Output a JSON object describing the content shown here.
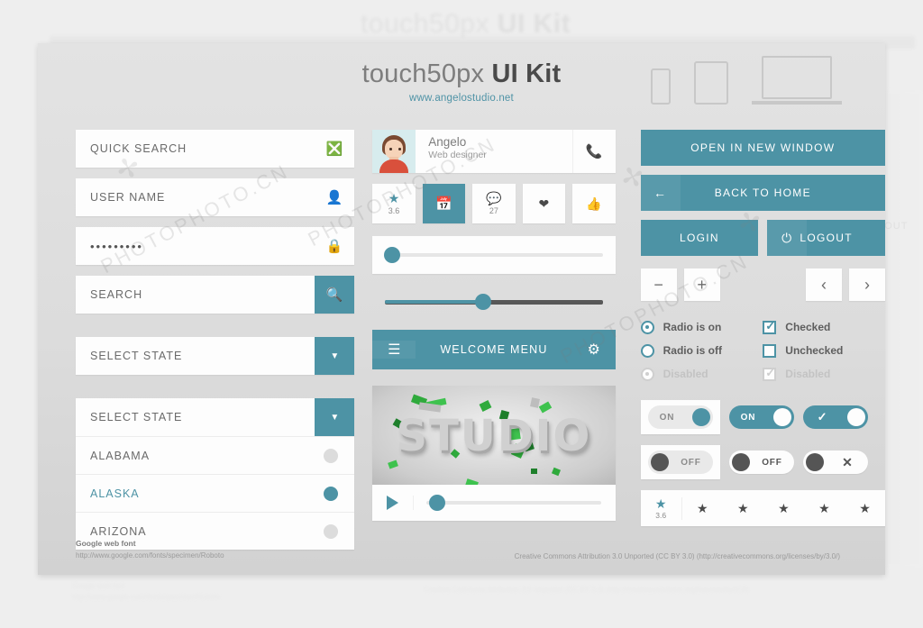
{
  "header": {
    "title_light": "touch50px",
    "title_bold": "UI Kit",
    "subtitle": "www.angelostudio.net",
    "devices": [
      "phone-icon",
      "tablet-icon",
      "laptop-icon"
    ]
  },
  "left_column": {
    "quick_search": {
      "label": "QUICK SEARCH",
      "icon": "close-circle-icon"
    },
    "user_name": {
      "label": "USER NAME",
      "icon": "user-icon"
    },
    "password": {
      "value": "•••••••••",
      "icon": "lock-icon"
    },
    "search": {
      "label": "SEARCH",
      "icon": "search-icon"
    },
    "select_state": {
      "label": "SELECT STATE",
      "icon": "chevron-down-icon"
    },
    "select_state_open": {
      "label": "SELECT STATE",
      "icon": "chevron-down-icon",
      "options": [
        {
          "label": "ALABAMA",
          "selected": false
        },
        {
          "label": "ALASKA",
          "selected": true
        },
        {
          "label": "ARIZONA",
          "selected": false
        }
      ]
    }
  },
  "mid_column": {
    "contact": {
      "name": "Angelo",
      "role": "Web designer",
      "action_icon": "phone-icon"
    },
    "icon_tiles": [
      {
        "icon": "star-icon",
        "value": "3.6",
        "active": false
      },
      {
        "icon": "calendar-icon",
        "value": "",
        "active": true
      },
      {
        "icon": "comment-icon",
        "value": "27",
        "active": false
      },
      {
        "icon": "heart-icon",
        "value": "",
        "active": false
      },
      {
        "icon": "thumbs-up-icon",
        "value": "",
        "active": false
      }
    ],
    "slider_card": {
      "value": 2
    },
    "slider_bare": {
      "value": 45
    },
    "menu_bar": {
      "title": "WELCOME MENU",
      "left_icon": "hamburger-icon",
      "right_icon": "gear-icon"
    },
    "player": {
      "poster_text": "STUDIO",
      "play_icon": "play-icon",
      "progress": 6
    }
  },
  "right_column": {
    "buttons": {
      "open_new_window": "OPEN IN NEW WINDOW",
      "back_to_home": "BACK TO HOME",
      "back_icon": "back-arrow-icon",
      "login": "LOGIN",
      "logout": "LOGOUT",
      "power_icon": "power-icon"
    },
    "steppers": {
      "minus": "−",
      "plus": "+",
      "prev": "‹",
      "next": "›"
    },
    "choices": {
      "left": [
        {
          "label": "Radio is on",
          "state": "on"
        },
        {
          "label": "Radio is off",
          "state": "off"
        },
        {
          "label": "Disabled",
          "state": "disabled"
        }
      ],
      "right": [
        {
          "label": "Checked",
          "state": "checked"
        },
        {
          "label": "Unchecked",
          "state": "unchecked"
        },
        {
          "label": "Disabled",
          "state": "disabled"
        }
      ]
    },
    "toggles": {
      "row1": [
        {
          "label": "ON",
          "style": "lite-boxed"
        },
        {
          "label": "ON",
          "style": "teal"
        },
        {
          "label": "check-icon",
          "style": "teal-check"
        }
      ],
      "row2": [
        {
          "label": "OFF",
          "style": "lite-boxed"
        },
        {
          "label": "OFF",
          "style": "white"
        },
        {
          "label": "close-icon",
          "style": "white-x"
        }
      ]
    },
    "rating": {
      "value": "3.6",
      "stars": 6,
      "filled": 1,
      "icon": "star-icon"
    }
  },
  "footer": {
    "credit_title": "Google web font",
    "credit_url": "http://www.google.com/fonts/specimen/Roboto",
    "license": "Creative Commons Attribution 3.0 Unported (CC BY 3.0)  (http://creativecommons.org/licenses/by/3.0/)"
  },
  "colors": {
    "accent": "#4d93a5",
    "panel": "#dcdcdc",
    "field": "#fdfdfd",
    "text": "#6a6a6a"
  },
  "watermark": {
    "text": "PHOTOPHOTO.CN"
  }
}
